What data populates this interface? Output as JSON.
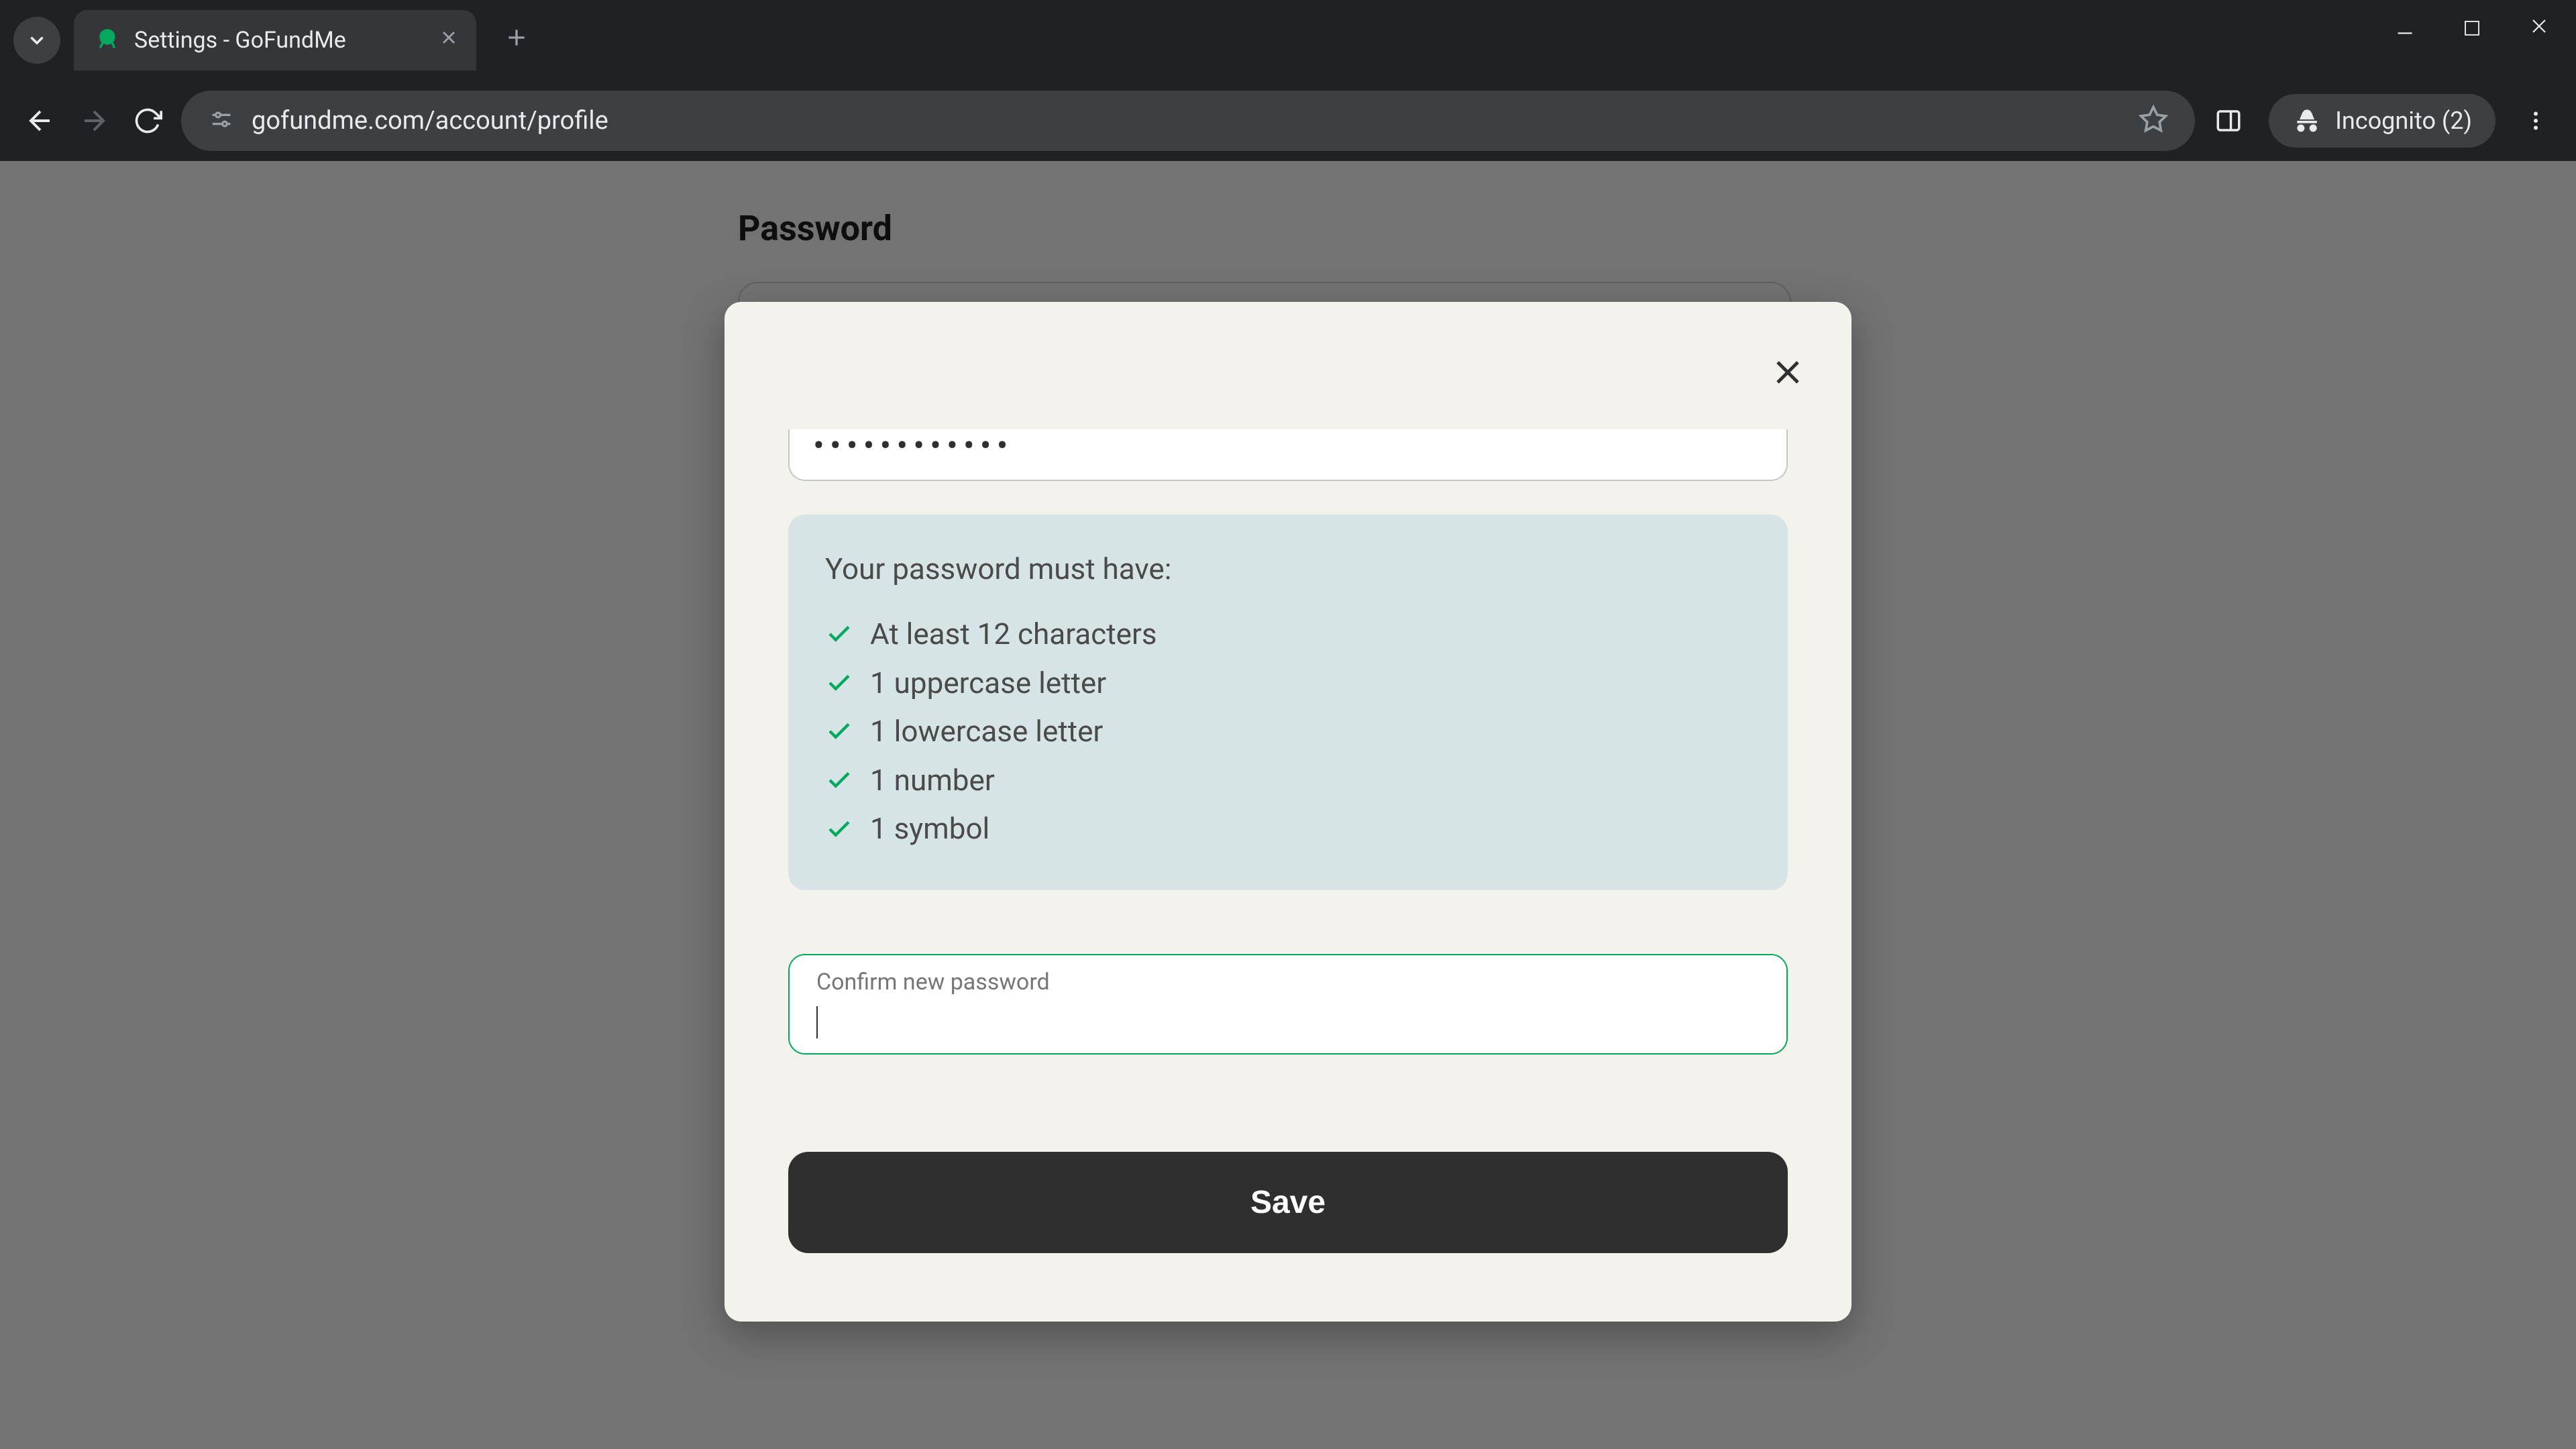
{
  "browser": {
    "tab_title": "Settings - GoFundMe",
    "url": "gofundme.com/account/profile",
    "incognito_label": "Incognito (2)"
  },
  "page": {
    "heading": "Password"
  },
  "modal": {
    "password_dots": "••••••••••••",
    "requirements": {
      "title": "Your password must have:",
      "items": [
        "At least 12 characters",
        "1 uppercase letter",
        "1 lowercase letter",
        "1 number",
        "1 symbol"
      ]
    },
    "confirm_label": "Confirm new password",
    "confirm_value": "",
    "save_label": "Save"
  }
}
